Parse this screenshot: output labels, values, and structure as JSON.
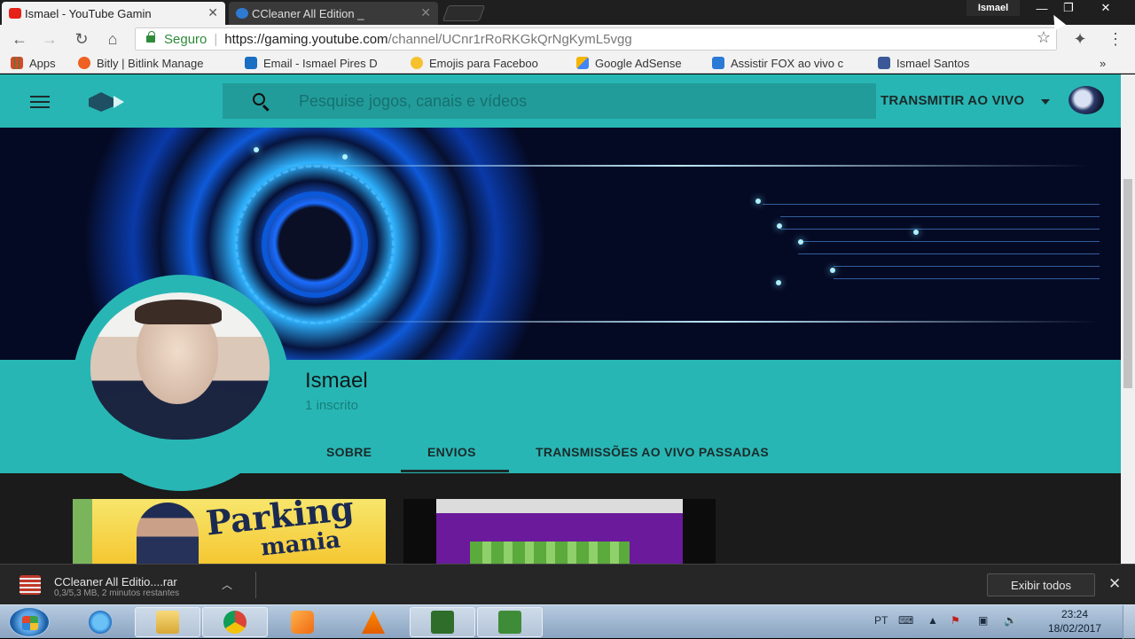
{
  "browser": {
    "tabs": [
      {
        "title": "Ismael - YouTube Gamin",
        "favicon_color": "#e62117",
        "active": true
      },
      {
        "title": "CCleaner All Edition _",
        "favicon_color": "#2f7ad1",
        "active": false
      }
    ],
    "profile_name": "Ismael",
    "window_controls": {
      "minimize": "—",
      "restore": "❐",
      "close": "✕"
    },
    "address_bar": {
      "security_label": "Seguro",
      "url_host": "https://gaming.youtube.com",
      "url_path": "/channel/UCnr1rRoRKGkQrNgKymL5vgg"
    },
    "bookmarks": [
      {
        "label": "Apps",
        "icon": "apps-grid-icon",
        "color": "#d44a2a"
      },
      {
        "label": "Bitly | Bitlink Manage",
        "icon": "bitly-icon",
        "color": "#ee6123"
      },
      {
        "label": "Email - Ismael Pires D",
        "icon": "outlook-icon",
        "color": "#1a6fc2"
      },
      {
        "label": "Emojis para Faceboo",
        "icon": "emoji-icon",
        "color": "#f5c12e"
      },
      {
        "label": "Google AdSense",
        "icon": "adsense-icon",
        "color": "#f4b400"
      },
      {
        "label": "Assistir FOX ao vivo c",
        "icon": "fox-icon",
        "color": "#2a7ad6"
      },
      {
        "label": "Ismael Santos",
        "icon": "facebook-icon",
        "color": "#3b5998"
      }
    ],
    "bookmarks_overflow": "»"
  },
  "app": {
    "search_placeholder": "Pesquise jogos, canais e vídeos",
    "live_button": "TRANSMITIR AO VIVO",
    "brand_color": "#28b6b4"
  },
  "channel": {
    "name": "Ismael",
    "subscribers": "1 inscrito",
    "tabs": [
      "SOBRE",
      "ENVIOS",
      "TRANSMISSÕES AO VIVO PASSADAS"
    ],
    "active_tab": "ENVIOS"
  },
  "videos": [
    {
      "thumb_text_1": "Parking",
      "thumb_text_2": "mania"
    },
    {
      "thumb_text_1": "",
      "thumb_text_2": ""
    }
  ],
  "download": {
    "file_name": "CCleaner All Editio....rar",
    "status": "0,3/5,3 MB, 2 minutos restantes",
    "show_all": "Exibir todos"
  },
  "taskbar": {
    "language": "PT",
    "time": "23:24",
    "date": "18/02/2017"
  }
}
